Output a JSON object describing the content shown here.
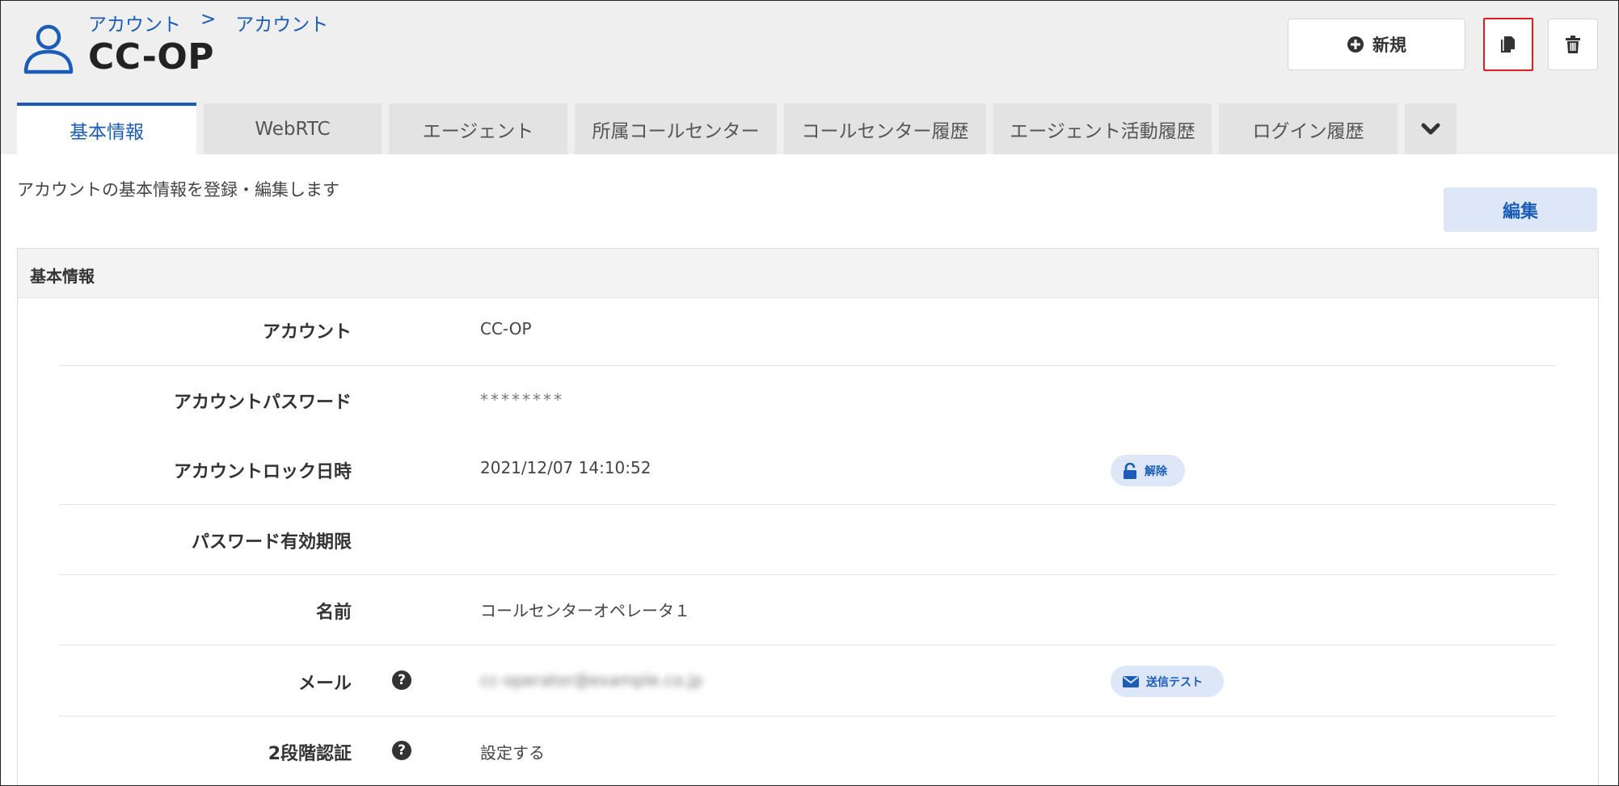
{
  "header": {
    "breadcrumb": [
      "アカウント",
      "アカウント"
    ],
    "breadcrumb_separator": ">",
    "title": "CC-OP",
    "icons": {
      "user": "user-icon",
      "plus": "plus-circle-icon",
      "copy": "copy-icon",
      "trash": "trash-icon"
    },
    "new_button_label": "新規"
  },
  "tabs": [
    {
      "label": "基本情報",
      "active": true
    },
    {
      "label": "WebRTC",
      "active": false
    },
    {
      "label": "エージェント",
      "active": false
    },
    {
      "label": "所属コールセンター",
      "active": false
    },
    {
      "label": "コールセンター履歴",
      "active": false
    },
    {
      "label": "エージェント活動履歴",
      "active": false
    },
    {
      "label": "ログイン履歴",
      "active": false
    }
  ],
  "tab_more_icon": "chevron-down-icon",
  "main": {
    "description": "アカウントの基本情報を登録・編集します",
    "edit_button_label": "編集"
  },
  "panel": {
    "title": "基本情報",
    "rows": [
      {
        "label": "アカウント",
        "value": "CC-OP"
      },
      {
        "label": "アカウントパスワード",
        "value": "********"
      },
      {
        "label": "アカウントロック日時",
        "value": "2021/12/07 14:10:52",
        "action": "解除"
      },
      {
        "label": "パスワード有効期限",
        "value": ""
      },
      {
        "label": "名前",
        "value": "コールセンターオペレータ１"
      },
      {
        "label": "メール",
        "value": "cc-operator@example.co.jp",
        "action": "送信テスト"
      },
      {
        "label": "2段階認証",
        "value": "設定する"
      }
    ]
  },
  "colors": {
    "accent": "#1a5cb8",
    "highlight_border": "#e01c1c",
    "header_bg": "#efefef"
  }
}
